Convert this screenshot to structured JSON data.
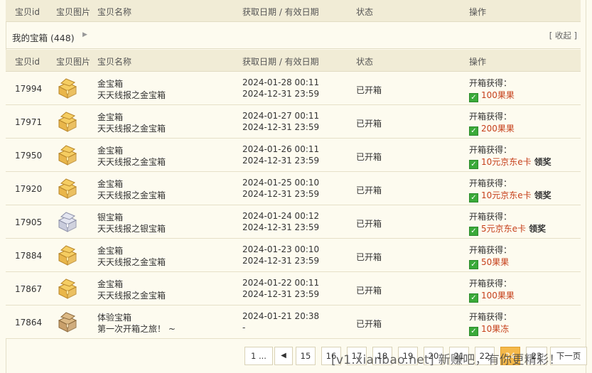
{
  "columns": {
    "id": "宝贝id",
    "image": "宝贝图片",
    "name": "宝贝名称",
    "dates": "获取日期 / 有效日期",
    "status": "状态",
    "action": "操作"
  },
  "section": {
    "title": "我的宝箱 (448)",
    "collapse_label": "[ 收起 ]"
  },
  "items": [
    {
      "id": "17994",
      "box": "gold",
      "name": "金宝箱",
      "source": "天天线报之金宝箱",
      "got": "2024-01-28 00:11",
      "expires": "2024-12-31 23:59",
      "status": "已开箱",
      "result_label": "开箱获得：",
      "prize": "100果果",
      "claim": ""
    },
    {
      "id": "17971",
      "box": "gold",
      "name": "金宝箱",
      "source": "天天线报之金宝箱",
      "got": "2024-01-27 00:11",
      "expires": "2024-12-31 23:59",
      "status": "已开箱",
      "result_label": "开箱获得：",
      "prize": "200果果",
      "claim": ""
    },
    {
      "id": "17950",
      "box": "gold",
      "name": "金宝箱",
      "source": "天天线报之金宝箱",
      "got": "2024-01-26 00:11",
      "expires": "2024-12-31 23:59",
      "status": "已开箱",
      "result_label": "开箱获得：",
      "prize": "10元京东e卡",
      "claim": "领奖"
    },
    {
      "id": "17920",
      "box": "gold",
      "name": "金宝箱",
      "source": "天天线报之金宝箱",
      "got": "2024-01-25 00:10",
      "expires": "2024-12-31 23:59",
      "status": "已开箱",
      "result_label": "开箱获得：",
      "prize": "10元京东e卡",
      "claim": "领奖"
    },
    {
      "id": "17905",
      "box": "silver",
      "name": "银宝箱",
      "source": "天天线报之银宝箱",
      "got": "2024-01-24 00:12",
      "expires": "2024-12-31 23:59",
      "status": "已开箱",
      "result_label": "开箱获得：",
      "prize": "5元京东e卡",
      "claim": "领奖"
    },
    {
      "id": "17884",
      "box": "gold",
      "name": "金宝箱",
      "source": "天天线报之金宝箱",
      "got": "2024-01-23 00:10",
      "expires": "2024-12-31 23:59",
      "status": "已开箱",
      "result_label": "开箱获得：",
      "prize": "50果果",
      "claim": ""
    },
    {
      "id": "17867",
      "box": "gold",
      "name": "金宝箱",
      "source": "天天线报之金宝箱",
      "got": "2024-01-22 00:11",
      "expires": "2024-12-31 23:59",
      "status": "已开箱",
      "result_label": "开箱获得：",
      "prize": "100果果",
      "claim": ""
    },
    {
      "id": "17864",
      "box": "wood",
      "name": "体验宝箱",
      "source": "第一次开箱之旅！ ~",
      "got": "2024-01-21 20:38",
      "expires": "-",
      "status": "已开箱",
      "result_label": "开箱获得：",
      "prize": "10果冻",
      "claim": ""
    }
  ],
  "pagination": {
    "first": "1 ...",
    "prev": "◀",
    "pages": [
      "15",
      "16",
      "17",
      "18",
      "19",
      "20",
      "21",
      "22",
      "23",
      "24"
    ],
    "current": "24",
    "next": "下一页"
  },
  "watermark": "[v1.xianbao.net] 新赚吧，有你更精彩！",
  "colors": {
    "background": "#fdfbef",
    "header_bg": "#f1ecd6",
    "prize": "#c6401b",
    "check": "#3aaa3a",
    "current_page": "#f5b94a"
  }
}
